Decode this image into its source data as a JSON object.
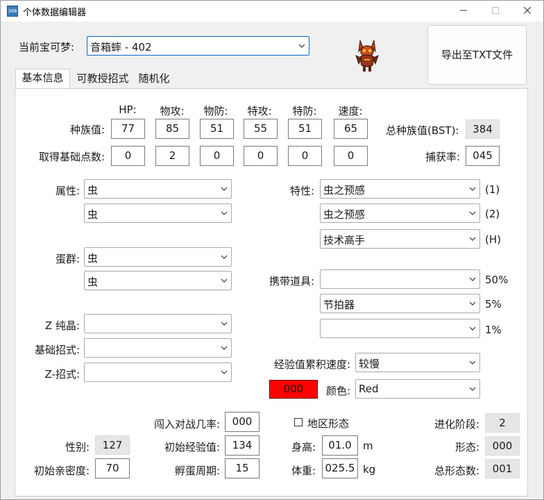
{
  "window": {
    "title": "个体数据编辑器",
    "app_icon_text": "308"
  },
  "header": {
    "current_label": "当前宝可梦:",
    "current_value": "音箱蟀 - 402",
    "export_button": "导出至TXT文件"
  },
  "tabs": [
    {
      "label": "基本信息",
      "active": true
    },
    {
      "label": "可教授招式",
      "active": false
    },
    {
      "label": "随机化",
      "active": false
    }
  ],
  "stats": {
    "headers": [
      "HP:",
      "物攻:",
      "物防:",
      "特攻:",
      "特防:",
      "速度:"
    ],
    "base_label": "种族值:",
    "base_values": [
      "77",
      "85",
      "51",
      "55",
      "51",
      "65"
    ],
    "ev_label": "取得基础点数:",
    "ev_values": [
      "0",
      "2",
      "0",
      "0",
      "0",
      "0"
    ],
    "bst_label": "总种族值(BST):",
    "bst_value": "384",
    "catch_label": "捕获率:",
    "catch_value": "045"
  },
  "left": {
    "type_label": "属性:",
    "type1": "虫",
    "type2": "虫",
    "egg_label": "蛋群:",
    "egg1": "虫",
    "egg2": "虫",
    "z_crystal_label": "Z 纯晶:",
    "z_crystal": "",
    "base_move_label": "基础招式:",
    "base_move": "",
    "z_move_label": "Z-招式:",
    "z_move": ""
  },
  "right": {
    "ability_label": "特性:",
    "abilities": [
      {
        "value": "虫之预感",
        "slot": "(1)"
      },
      {
        "value": "虫之预感",
        "slot": "(2)"
      },
      {
        "value": "技术高手",
        "slot": "(H)"
      }
    ],
    "item_label": "携带道具:",
    "items": [
      {
        "value": "",
        "rate": "50%"
      },
      {
        "value": "节拍器",
        "rate": "5%"
      },
      {
        "value": "",
        "rate": "1%"
      }
    ],
    "exp_label": "经验值累积速度:",
    "exp_value": "较慢",
    "color_swatch_text": "000",
    "color_label": "颜色:",
    "color_value": "Red"
  },
  "bottom": {
    "encounter_label": "闯入对战几率:",
    "encounter_value": "000",
    "regional_label": "地区形态",
    "regional_checked": false,
    "evo_stage_label": "进化阶段:",
    "evo_stage_value": "2",
    "gender_label": "性别:",
    "gender_value": "127",
    "base_exp_label": "初始经验值:",
    "base_exp_value": "134",
    "height_label": "身高:",
    "height_value": "01.0",
    "height_unit": "m",
    "form_label": "形态:",
    "form_value": "000",
    "friendship_label": "初始亲密度:",
    "friendship_value": "70",
    "hatch_label": "孵蛋周期:",
    "hatch_value": "15",
    "weight_label": "体重:",
    "weight_value": "025.5",
    "weight_unit": "kg",
    "form_count_label": "总形态数:",
    "form_count_value": "001"
  },
  "colors": {
    "swatch": "#ff0000",
    "focus_border": "#0a64c8",
    "window_bg": "#f0f0f0"
  },
  "icons": [
    "app-icon",
    "minimize-icon",
    "maximize-icon",
    "close-icon",
    "chevron-down-icon",
    "pokemon-sprite-icon"
  ]
}
